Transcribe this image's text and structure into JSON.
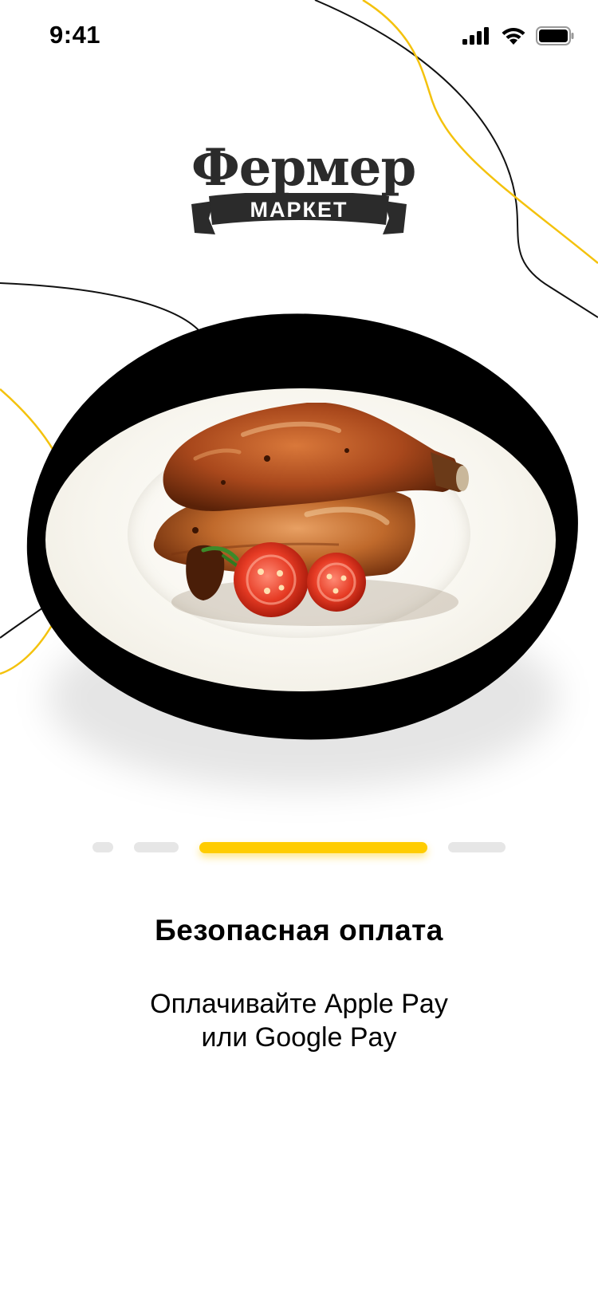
{
  "status_bar": {
    "time": "9:41"
  },
  "logo": {
    "word": "Фермер",
    "ribbon": "МАРКЕТ"
  },
  "onboarding": {
    "title": "Безопасная оплата",
    "subtitle_line1": "Оплачивайте Apple Pay",
    "subtitle_line2": "или Google Pay",
    "pages_total": 4,
    "active_page_index": 2
  },
  "colors": {
    "accent": "#ffcc00",
    "background": "#ffffff",
    "text": "#000000",
    "inactive_dot": "#e6e6e6"
  },
  "icons": [
    "signal-icon",
    "wifi-icon",
    "battery-icon"
  ]
}
